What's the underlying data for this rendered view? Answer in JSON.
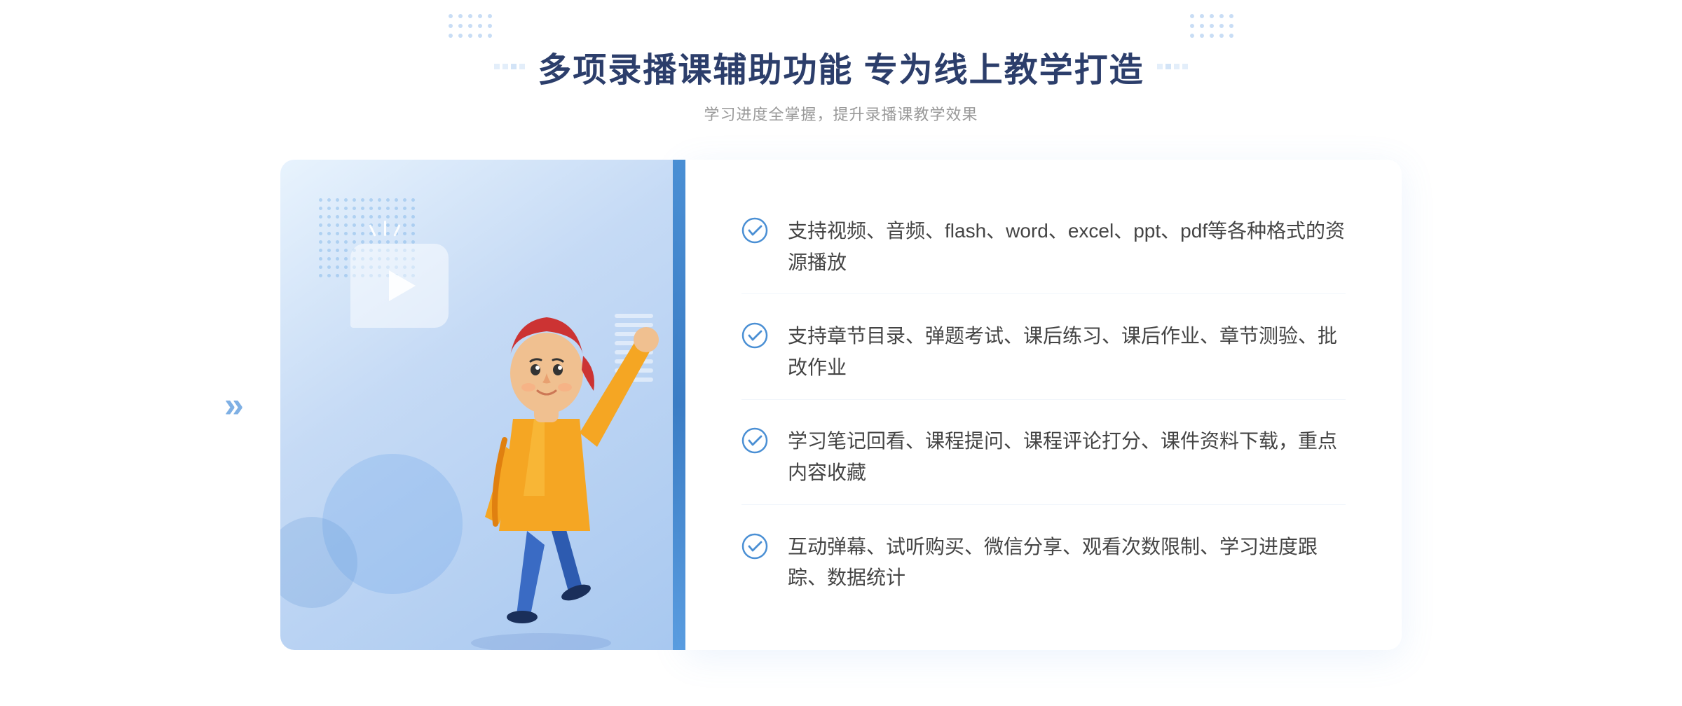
{
  "header": {
    "title": "多项录播课辅助功能 专为线上教学打造",
    "subtitle": "学习进度全掌握，提升录播课教学效果",
    "decoration_left": "❑❑",
    "decoration_right": "❑❑"
  },
  "features": [
    {
      "id": 1,
      "text": "支持视频、音频、flash、word、excel、ppt、pdf等各种格式的资源播放"
    },
    {
      "id": 2,
      "text": "支持章节目录、弹题考试、课后练习、课后作业、章节测验、批改作业"
    },
    {
      "id": 3,
      "text": "学习笔记回看、课程提问、课程评论打分、课件资料下载，重点内容收藏"
    },
    {
      "id": 4,
      "text": "互动弹幕、试听购买、微信分享、观看次数限制、学习进度跟踪、数据统计"
    }
  ],
  "colors": {
    "primary_blue": "#4a8fd4",
    "light_blue": "#a8c8f0",
    "text_dark": "#2c3e6b",
    "text_gray": "#999999",
    "text_feature": "#444444",
    "check_color": "#4a8fd4",
    "bg_gradient_start": "#e8f3fd",
    "bg_gradient_end": "#a8c8f0"
  },
  "chevron": {
    "left_symbol": "»"
  }
}
